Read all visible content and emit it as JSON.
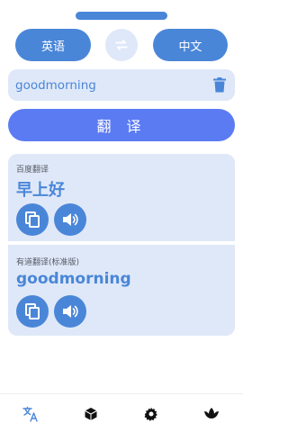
{
  "languages": {
    "source": "英语",
    "target": "中文"
  },
  "input": {
    "value": "goodmorning"
  },
  "translate_label": "翻 译",
  "results": [
    {
      "label": "百度翻译",
      "value": "早上好"
    },
    {
      "label": "有道翻译(标准版)",
      "value": "goodmorning"
    }
  ],
  "colors": {
    "primary": "#4a86d8",
    "accent": "#5b7bf3",
    "card": "#dfe8f8"
  },
  "icons": {
    "swap": "swap-icon",
    "delete": "trash-icon",
    "copy": "copy-icon",
    "speak": "speaker-icon",
    "nav": [
      "translate-icon",
      "cube-icon",
      "gear-icon",
      "lotus-icon"
    ]
  }
}
